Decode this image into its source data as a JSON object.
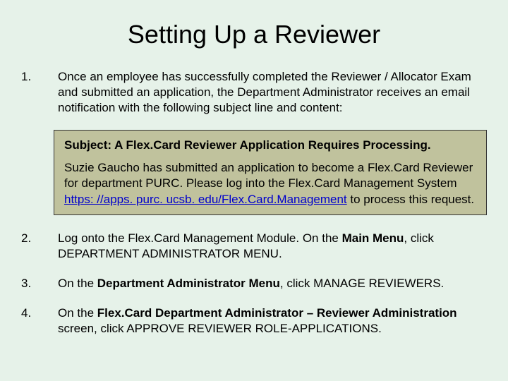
{
  "title": "Setting Up a Reviewer",
  "items": [
    {
      "num": "1.",
      "text": "Once an employee has successfully completed the Reviewer / Allocator Exam and submitted an application, the Department Administrator receives an email notification with the following subject line and content:"
    },
    {
      "num": "2.",
      "prefix": "Log onto the Flex.Card Management Module.  On the ",
      "bold1": "Main Menu",
      "suffix": ", click DEPARTMENT ADMINISTRATOR MENU."
    },
    {
      "num": "3.",
      "prefix": "On the ",
      "bold1": "Department Administrator Menu",
      "suffix": ", click MANAGE REVIEWERS."
    },
    {
      "num": "4.",
      "prefix": "On the ",
      "bold1": "Flex.Card Department Administrator – Reviewer Administration",
      "suffix": " screen, click APPROVE REVIEWER ROLE-APPLICATIONS."
    }
  ],
  "email": {
    "subject_label": "Subject: A Flex.Card Reviewer Application Requires Processing.",
    "body_before_link": "Suzie Gaucho has submitted an application to become a Flex.Card Reviewer for department PURC.  Please log into the Flex.Card Management System ",
    "link_text": "https: //apps. purc. ucsb. edu/Flex.Card.Management",
    "body_after_link": " to process this request."
  }
}
